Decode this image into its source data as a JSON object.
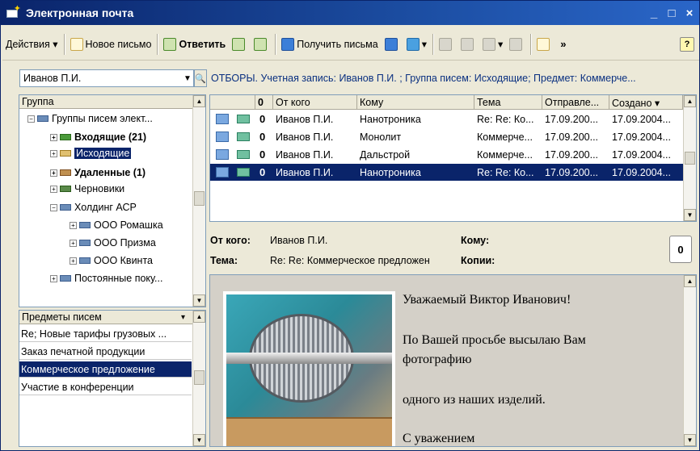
{
  "window": {
    "title": "Электронная почта",
    "minimize": "_",
    "maximize": "□",
    "close": "×"
  },
  "toolbar": {
    "actions": "Действия ▾",
    "new_letter": "Новое письмо",
    "reply": "Ответить",
    "get_mail": "Получить письма",
    "more": "»",
    "help": "?"
  },
  "user_select": {
    "value": "Иванов П.И."
  },
  "filters_text": "ОТБОРЫ. Учетная запись: Иванов П.И. ; Группа писем: Исходящие; Предмет: Коммерче...",
  "groups": {
    "header": "Группа",
    "items": [
      {
        "label": "Группы писем элект...",
        "pm": "−"
      },
      {
        "label": "Входящие (21)",
        "pm": "+"
      },
      {
        "label": "Исходящие",
        "pm": "+"
      },
      {
        "label": "Удаленные (1)",
        "pm": "+"
      },
      {
        "label": "Черновики",
        "pm": "+"
      },
      {
        "label": "Холдинг АСР",
        "pm": "−"
      },
      {
        "label": "ООО Ромашка",
        "pm": "+"
      },
      {
        "label": "ООО Призма",
        "pm": "+"
      },
      {
        "label": "ООО Квинта",
        "pm": "+"
      },
      {
        "label": "Постоянные поку...",
        "pm": "+"
      }
    ]
  },
  "subjects": {
    "header": "Предметы писем",
    "items": [
      "Re; Новые тарифы грузовых ...",
      "Заказ печатной продукции",
      "Коммерческое предложение",
      "Участие в конференции"
    ]
  },
  "grid": {
    "columns": {
      "attach": "0",
      "from": "От кого",
      "to": "Кому",
      "subject": "Тема",
      "sent": "Отправле...",
      "created": "Создано ▾"
    },
    "rows": [
      {
        "attach": "0",
        "from": "Иванов П.И.",
        "to": "Нанотроника",
        "subject": "Re: Re: Ко...",
        "sent": "17.09.200...",
        "created": "17.09.2004..."
      },
      {
        "attach": "0",
        "from": "Иванов П.И.",
        "to": "Монолит",
        "subject": "Коммерче...",
        "sent": "17.09.200...",
        "created": "17.09.2004..."
      },
      {
        "attach": "0",
        "from": "Иванов П.И.",
        "to": "Дальстрой",
        "subject": "Коммерче...",
        "sent": "17.09.200...",
        "created": "17.09.2004..."
      },
      {
        "attach": "0",
        "from": "Иванов П.И.",
        "to": "Нанотроника",
        "subject": "Re: Re: Ко...",
        "sent": "17.09.200...",
        "created": "17.09.2004..."
      }
    ]
  },
  "details": {
    "from_label": "От кого:",
    "from_value": "Иванов П.И.",
    "to_label": "Кому:",
    "subject_label": "Тема:",
    "subject_value": "Re: Re: Коммерческое предложен",
    "cc_label": "Копии:",
    "attach_label": "0"
  },
  "message": {
    "greeting": "Уважаемый Виктор Иванович!",
    "line1": "По Вашей просьбе высылаю Вам",
    "line2": "фотографию",
    "line3": "одного из наших изделий.",
    "line4": "С уважением"
  },
  "colors": {
    "selection": "#0a246a",
    "title_bar": "#0a246a",
    "filters_text": "#0a3080"
  }
}
